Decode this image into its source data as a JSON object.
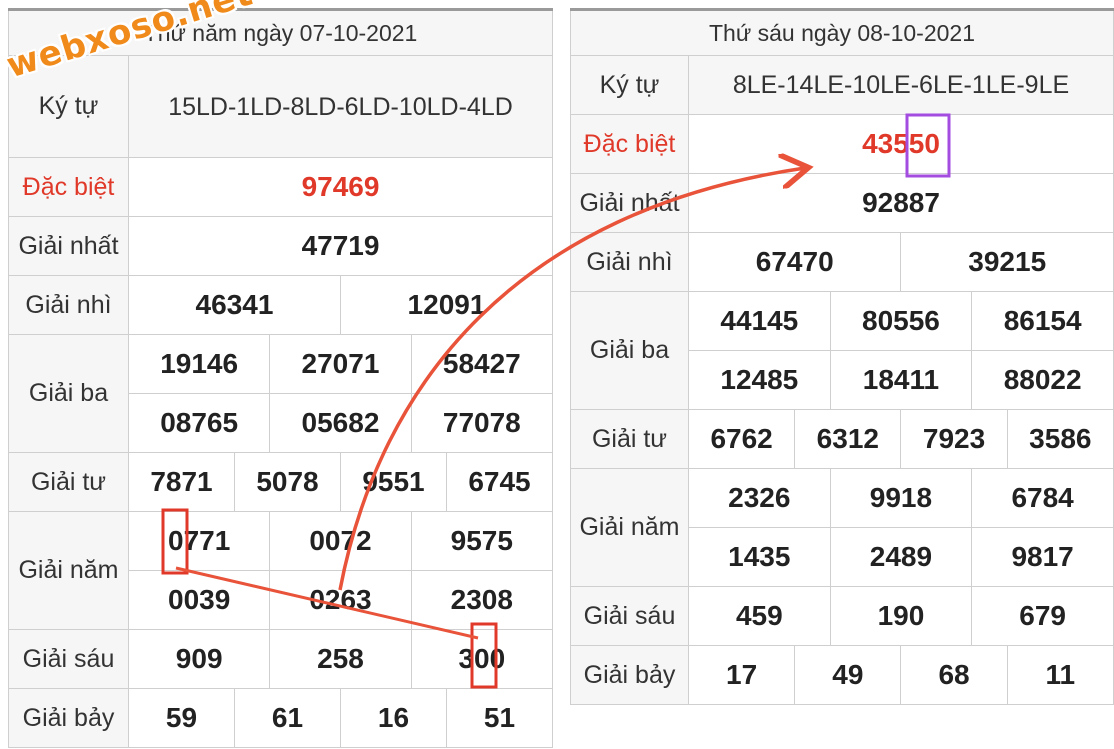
{
  "watermark": "webxoso.net",
  "left": {
    "header": "Thứ năm ngày 07-10-2021",
    "kytu_label": "Ký tự",
    "kytu_value": "15LD-1LD-8LD-6LD-10LD-4LD",
    "dacbiet_label": "Đặc biệt",
    "dacbiet": "97469",
    "nhat_label": "Giải nhất",
    "nhat": "47719",
    "nhi_label": "Giải nhì",
    "nhi": [
      "46341",
      "12091"
    ],
    "ba_label": "Giải ba",
    "ba": [
      "19146",
      "27071",
      "58427",
      "08765",
      "05682",
      "77078"
    ],
    "tu_label": "Giải tư",
    "tu": [
      "7871",
      "5078",
      "9551",
      "6745"
    ],
    "nam_label": "Giải năm",
    "nam": [
      "0771",
      "0072",
      "9575",
      "0039",
      "0263",
      "2308"
    ],
    "sau_label": "Giải sáu",
    "sau": [
      "909",
      "258",
      "300"
    ],
    "bay_label": "Giải bảy",
    "bay": [
      "59",
      "61",
      "16",
      "51"
    ]
  },
  "right": {
    "header": "Thứ sáu ngày 08-10-2021",
    "kytu_label": "Ký tự",
    "kytu_value": "8LE-14LE-10LE-6LE-1LE-9LE",
    "dacbiet_label": "Đặc biệt",
    "dacbiet": "43550",
    "nhat_label": "Giải nhất",
    "nhat": "92887",
    "nhi_label": "Giải nhì",
    "nhi": [
      "67470",
      "39215"
    ],
    "ba_label": "Giải ba",
    "ba": [
      "44145",
      "80556",
      "86154",
      "12485",
      "18411",
      "88022"
    ],
    "tu_label": "Giải tư",
    "tu": [
      "6762",
      "6312",
      "7923",
      "3586"
    ],
    "nam_label": "Giải năm",
    "nam": [
      "2326",
      "9918",
      "6784",
      "1435",
      "2489",
      "9817"
    ],
    "sau_label": "Giải sáu",
    "sau": [
      "459",
      "190",
      "679"
    ],
    "bay_label": "Giải bảy",
    "bay": [
      "17",
      "49",
      "68",
      "11"
    ]
  },
  "annotations": {
    "box_color": "#e0392a",
    "highlight_color": "#a44be0",
    "arrow_color": "#e8533a"
  }
}
